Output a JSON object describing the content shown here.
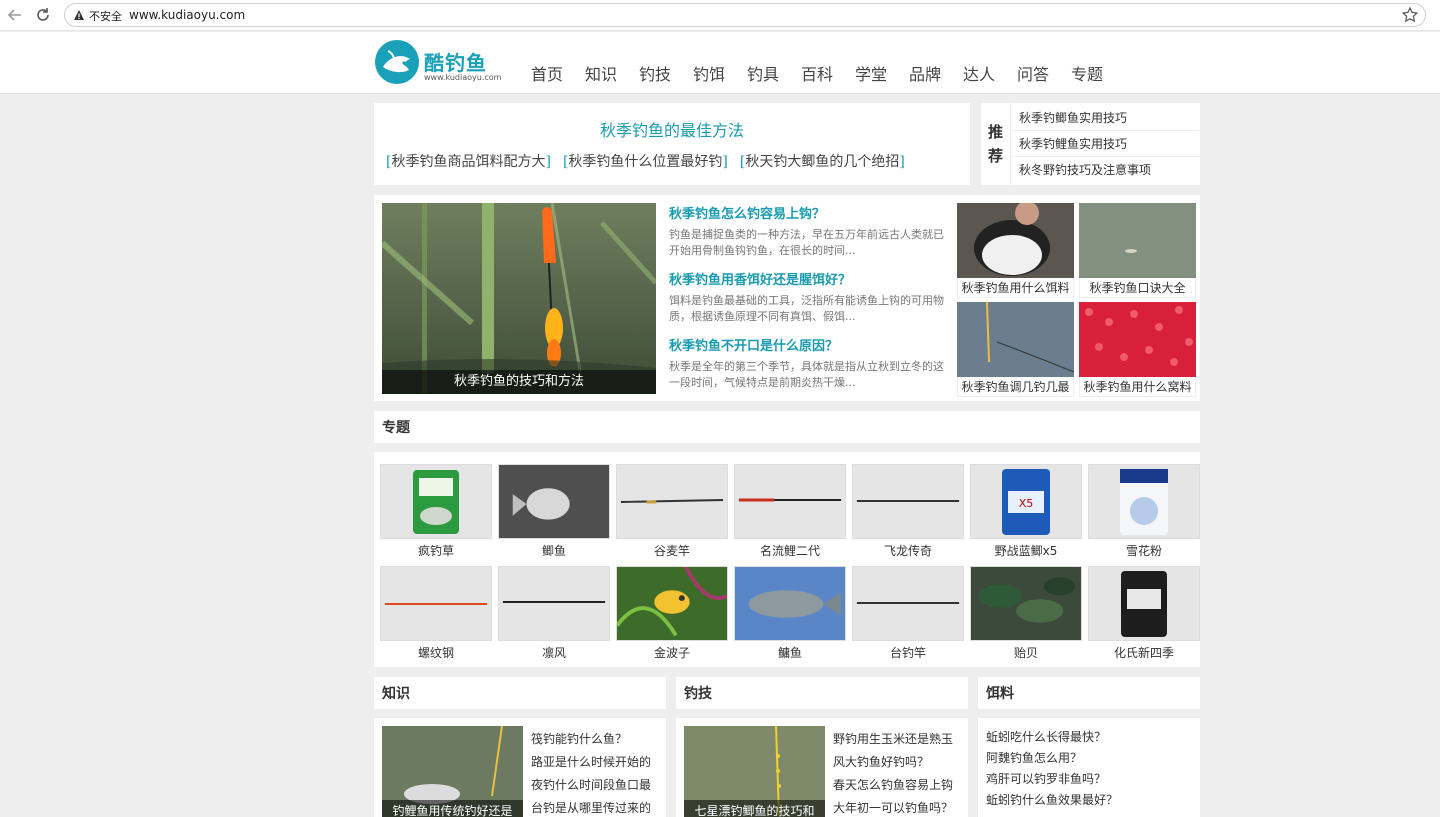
{
  "browser": {
    "security_label": "不安全",
    "url": "www.kudiaoyu.com"
  },
  "logo": {
    "name": "酷钓鱼",
    "domain": "www.kudiaoyu.com"
  },
  "nav": [
    "首页",
    "知识",
    "钓技",
    "钓饵",
    "钓具",
    "百科",
    "学堂",
    "品牌",
    "达人",
    "问答",
    "专题"
  ],
  "banner": {
    "title": "秋季钓鱼的最佳方法",
    "links": [
      "秋季钓鱼商品饵料配方大",
      "秋季钓鱼什么位置最好钓",
      "秋天钓大鲫鱼的几个绝招"
    ]
  },
  "recommend": {
    "heading_1": "推",
    "heading_2": "荐",
    "items": [
      "秋季钓鲫鱼实用技巧",
      "秋季钓鲤鱼实用技巧",
      "秋冬野钓技巧及注意事项"
    ]
  },
  "feature": {
    "caption": "秋季钓鱼的技巧和方法",
    "articles": [
      {
        "title": "秋季钓鱼怎么钓容易上钩？",
        "desc": "钓鱼是捕捉鱼类的一种方法，早在五万年前远古人类就已开始用骨制鱼钩钓鱼，在很长的时间..."
      },
      {
        "title": "秋季钓鱼用香饵好还是腥饵好？",
        "desc": "饵料是钓鱼最基础的工具，泛指所有能诱鱼上钩的可用物质，根据诱鱼原理不同有真饵、假饵..."
      },
      {
        "title": "秋季钓鱼不开口是什么原因？",
        "desc": "秋季是全年的第三个季节，具体就是指从立秋到立冬的这一段时间，气候特点是前期炎热干燥..."
      }
    ],
    "thumbs": [
      "秋季钓鱼用什么饵料",
      "秋季钓鱼口诀大全",
      "秋季钓鱼调几钓几最",
      "秋季钓鱼用什么窝料"
    ]
  },
  "topics": {
    "title": "专题",
    "items": [
      "疯钓草",
      "鲫鱼",
      "谷麦竿",
      "名流鲤二代",
      "飞龙传奇",
      "野战蓝鲫x5",
      "雪花粉",
      "螺纹钢",
      "凛风",
      "金波子",
      "鳙鱼",
      "台钓竿",
      "贻贝",
      "化氏新四季"
    ]
  },
  "knowledge": {
    "title": "知识",
    "caption": "钓鲤鱼用传统钓好还是",
    "items": [
      "筏钓能钓什么鱼？",
      "路亚是什么时候开始的",
      "夜钓什么时间段鱼口最",
      "台钓是从哪里传过来的"
    ]
  },
  "technique": {
    "title": "钓技",
    "caption": "七星漂钓鲫鱼的技巧和",
    "items": [
      "野钓用生玉米还是熟玉",
      "风大钓鱼好钓吗？",
      "春天怎么钓鱼容易上钩",
      "大年初一可以钓鱼吗？"
    ]
  },
  "bait": {
    "title": "饵料",
    "items": [
      "蚯蚓吃什么长得最快？",
      "阿魏钓鱼怎么用？",
      "鸡肝可以钓罗非鱼吗？",
      "蚯蚓钓什么鱼效果最好？"
    ]
  }
}
